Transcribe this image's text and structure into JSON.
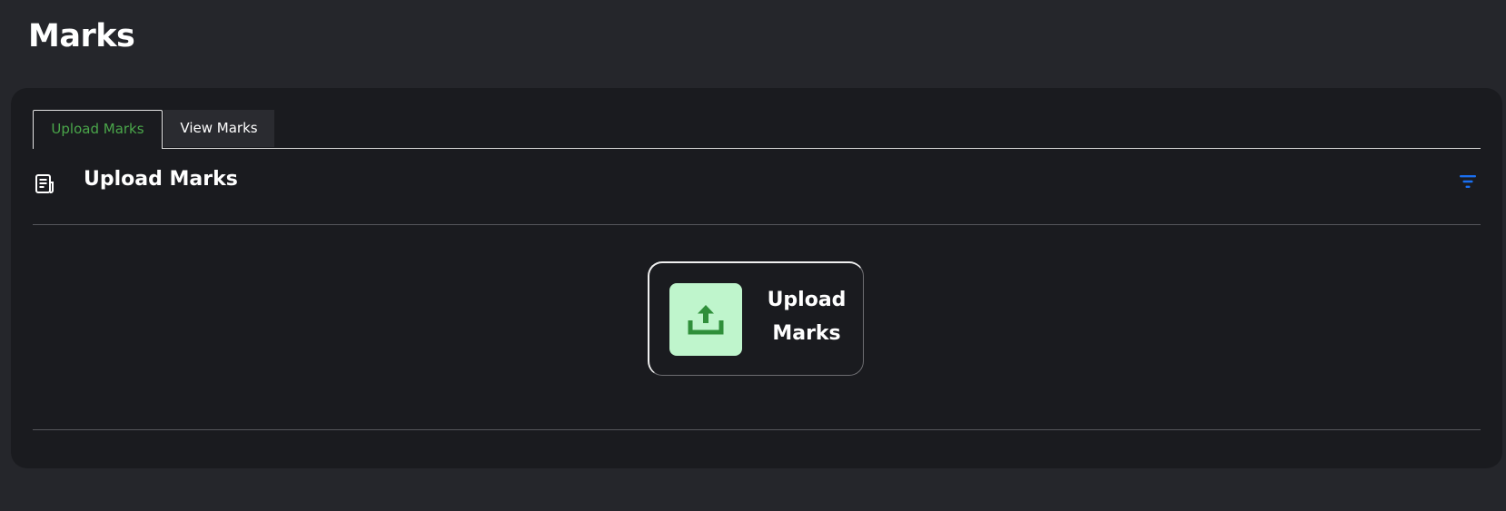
{
  "page": {
    "title": "Marks"
  },
  "tabs": [
    {
      "label": "Upload Marks",
      "active": true
    },
    {
      "label": "View Marks",
      "active": false
    }
  ],
  "section": {
    "title": "Upload Marks",
    "icon": "document-icon",
    "filter_icon": "filter-icon"
  },
  "upload_card": {
    "line1": "Upload",
    "line2": "Marks",
    "icon": "upload-icon"
  },
  "colors": {
    "background": "#25262b",
    "panel": "#1a1b1f",
    "active_tab_text": "#4aa64a",
    "filter_accent": "#1a6ff0",
    "upload_icon_bg": "#bff5cc",
    "upload_icon_fg": "#2f8f3a"
  }
}
